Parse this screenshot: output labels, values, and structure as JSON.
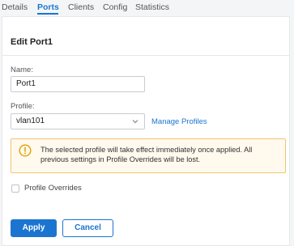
{
  "tabs": [
    {
      "label": "Details"
    },
    {
      "label": "Ports"
    },
    {
      "label": "Clients"
    },
    {
      "label": "Config"
    },
    {
      "label": "Statistics"
    }
  ],
  "active_tab": "Ports",
  "panel": {
    "title": "Edit Port1",
    "name_label": "Name:",
    "name_value": "Port1",
    "profile_label": "Profile:",
    "profile_value": "vlan101",
    "manage_link": "Manage Profiles",
    "warning_text": "The selected profile will take effect immediately once applied. All previous settings in Profile Overrides will be lost.",
    "overrides_label": "Profile Overrides",
    "overrides_checked": false,
    "apply_label": "Apply",
    "cancel_label": "Cancel"
  },
  "colors": {
    "accent": "#1b75d0",
    "warning_border": "#f2c46f",
    "warning_icon": "#e0a100"
  },
  "icons": {
    "select_arrow": "chevron-down-icon",
    "warning": "warning-circle-icon"
  }
}
